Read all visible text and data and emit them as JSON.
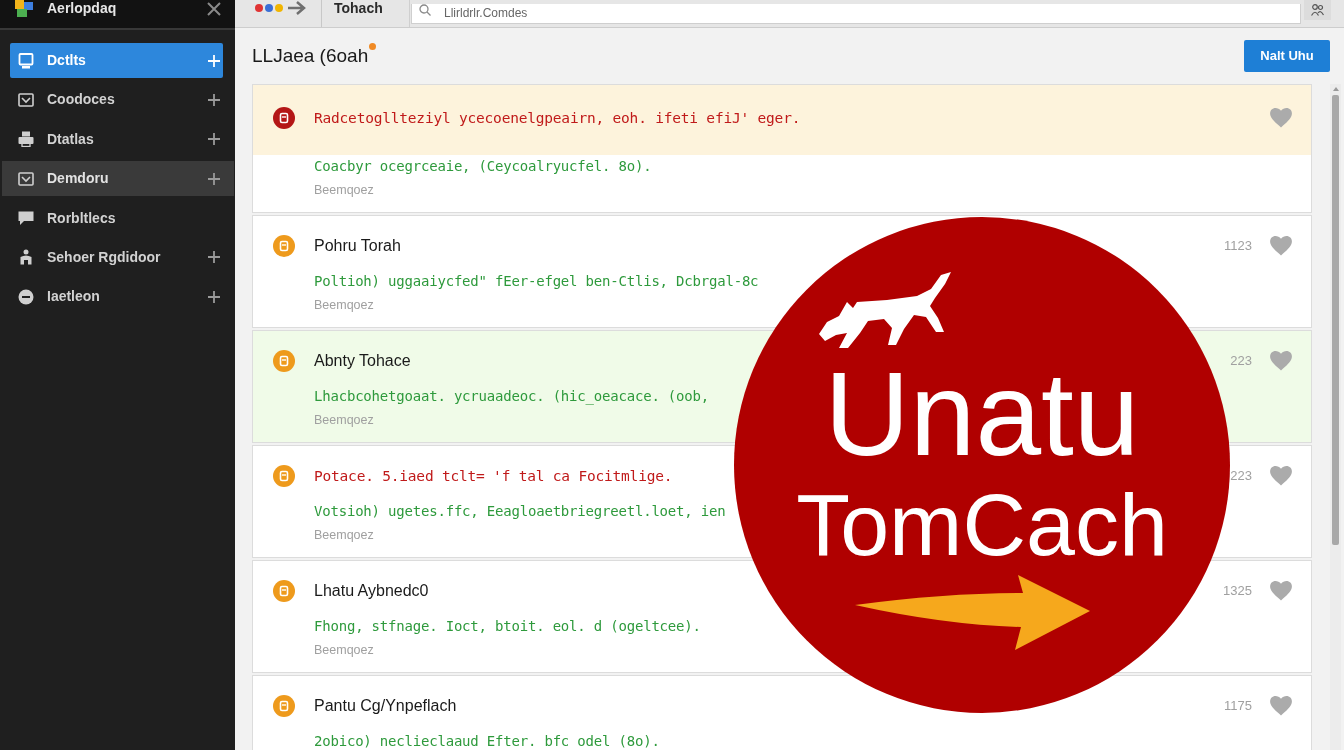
{
  "sidebar": {
    "title": "Aerlopdaq",
    "items": [
      {
        "label": "Dctlts",
        "selected": true,
        "highlighted": false,
        "addable": true
      },
      {
        "label": "Coodoces",
        "selected": false,
        "highlighted": false,
        "addable": true
      },
      {
        "label": "Dtatlas",
        "selected": false,
        "highlighted": false,
        "addable": true
      },
      {
        "label": "Demdoru",
        "selected": false,
        "highlighted": true,
        "addable": true
      },
      {
        "label": "Rorbltlecs",
        "selected": false,
        "highlighted": false,
        "addable": false
      },
      {
        "label": "Sehoer Rgdidoor",
        "selected": false,
        "highlighted": false,
        "addable": true
      },
      {
        "label": "Iaetleon",
        "selected": false,
        "highlighted": false,
        "addable": true
      }
    ]
  },
  "toolbar": {
    "tab": "Tohach",
    "search": {
      "placeholder": "Llirldrlr.Comdes"
    }
  },
  "header": {
    "title": "LLJaea (6oah",
    "notification": true,
    "button": "Nalt Uhu"
  },
  "cards": [
    {
      "kind": "warning",
      "title": "Radcetogllteziyl ycecoenelgpeairn, eoh. ifeti efiJ' eger.",
      "flagged": true,
      "color": "#b41616",
      "description": "Coacbyr ocegrceaie, (Ceycoalryucfel. 8o).",
      "meta": "Beemqoez"
    },
    {
      "kind": "plain",
      "title": "Pohru Torah",
      "flagged": false,
      "color": "#ee9a1c",
      "description": "Poltioh) uggaaiycfed\" fEer-efgel ben-Ctlis, Dcbrgal-8c",
      "meta": "Beemqoez",
      "count": "1123"
    },
    {
      "kind": "success",
      "title": "Abnty Tohace",
      "flagged": false,
      "color": "#ee9a1c",
      "description": "Lhacbcohetgoaat. ycruaadeoc. (hic_oeacace. (oob,",
      "meta": "Beemqoez",
      "count": "223"
    },
    {
      "kind": "plain",
      "title": "Potace. 5.iaed tclt= 'f tal ca Focitmlige.",
      "flagged": true,
      "color": "#ee9a1c",
      "description": "Votsioh) ugetes.ffc, Eeagloaetbriegreetl.loet, ien",
      "meta": "Beemqoez",
      "count": "223"
    },
    {
      "kind": "plain",
      "title": "Lhatu Aybnedc0",
      "flagged": false,
      "color": "#ee9a1c",
      "description": "Fhong, stfnage. Ioct, btoit. eol. d (ogeltcee).",
      "meta": "Beemqoez",
      "count": "1325"
    },
    {
      "kind": "plain",
      "title": "Pantu Cg/Ynpeflach",
      "flagged": false,
      "color": "#ee9a1c",
      "description": "2obico) neclieclaaud Efter. bfc odel (8o).",
      "count": "1175"
    }
  ],
  "logo": {
    "line_1": "Unatu",
    "line_2": "TomCach"
  }
}
